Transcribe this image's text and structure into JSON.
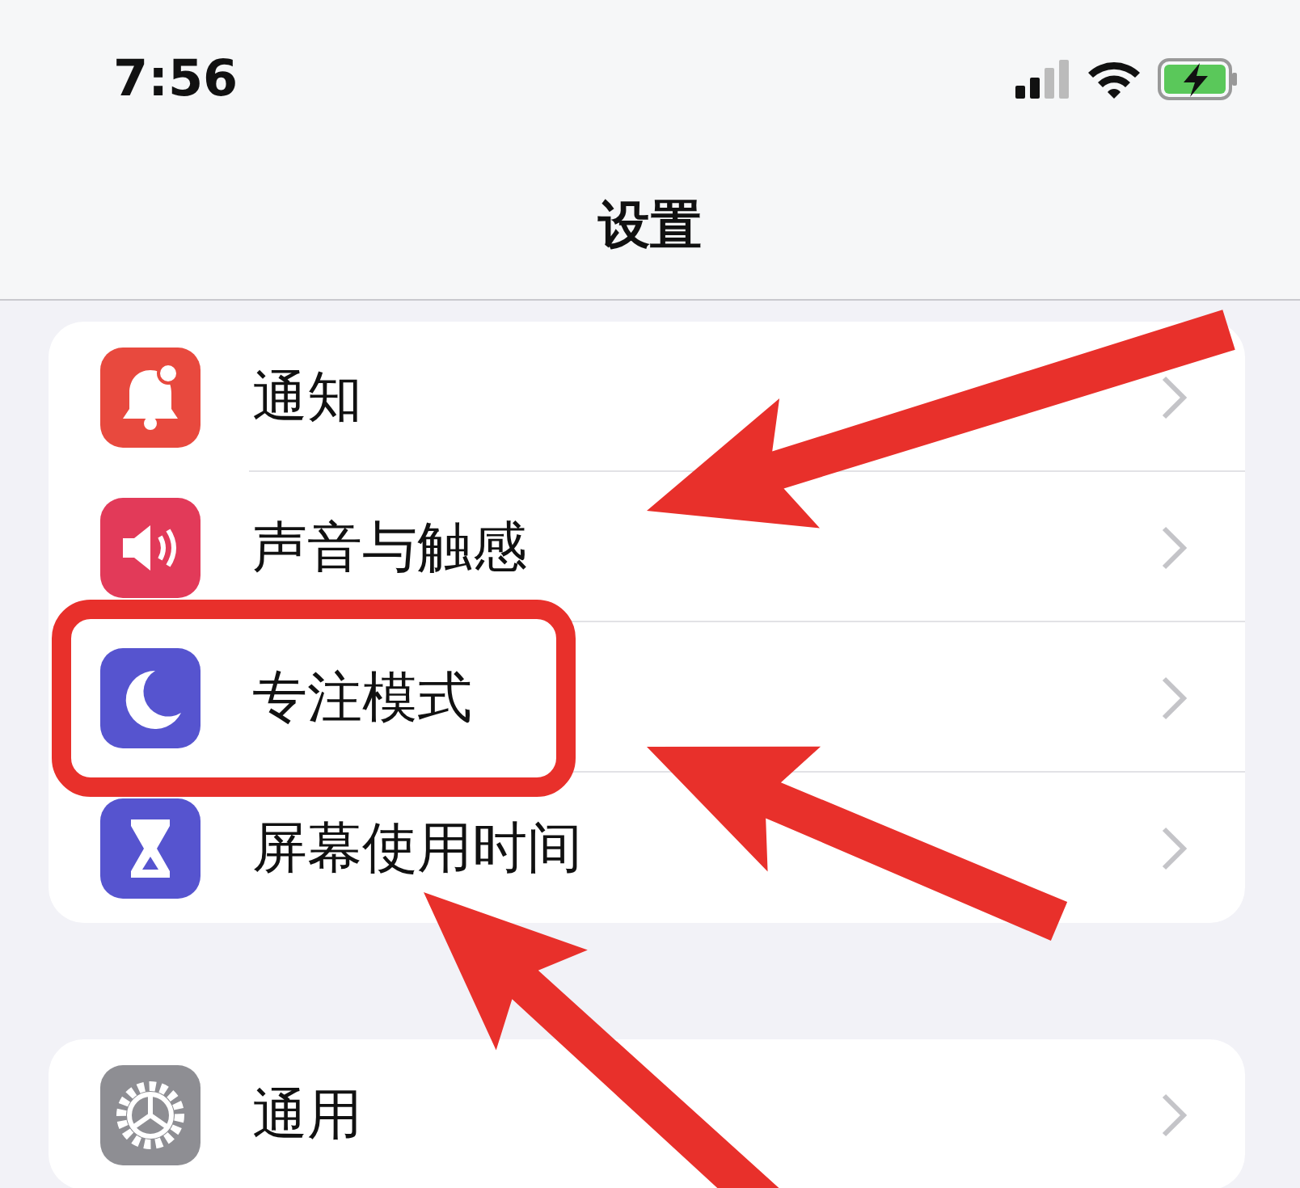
{
  "status_bar": {
    "time": "7:56"
  },
  "nav": {
    "title": "设置"
  },
  "groups": [
    {
      "items": [
        {
          "label": "通知",
          "kind": "bell",
          "highlighted": false
        },
        {
          "label": "声音与触感",
          "kind": "speaker",
          "highlighted": false
        },
        {
          "label": "专注模式",
          "kind": "moon",
          "highlighted": true
        },
        {
          "label": "屏幕使用时间",
          "kind": "hourglass",
          "highlighted": false
        }
      ]
    },
    {
      "items": [
        {
          "label": "通用",
          "kind": "gear",
          "highlighted": false
        }
      ]
    }
  ]
}
